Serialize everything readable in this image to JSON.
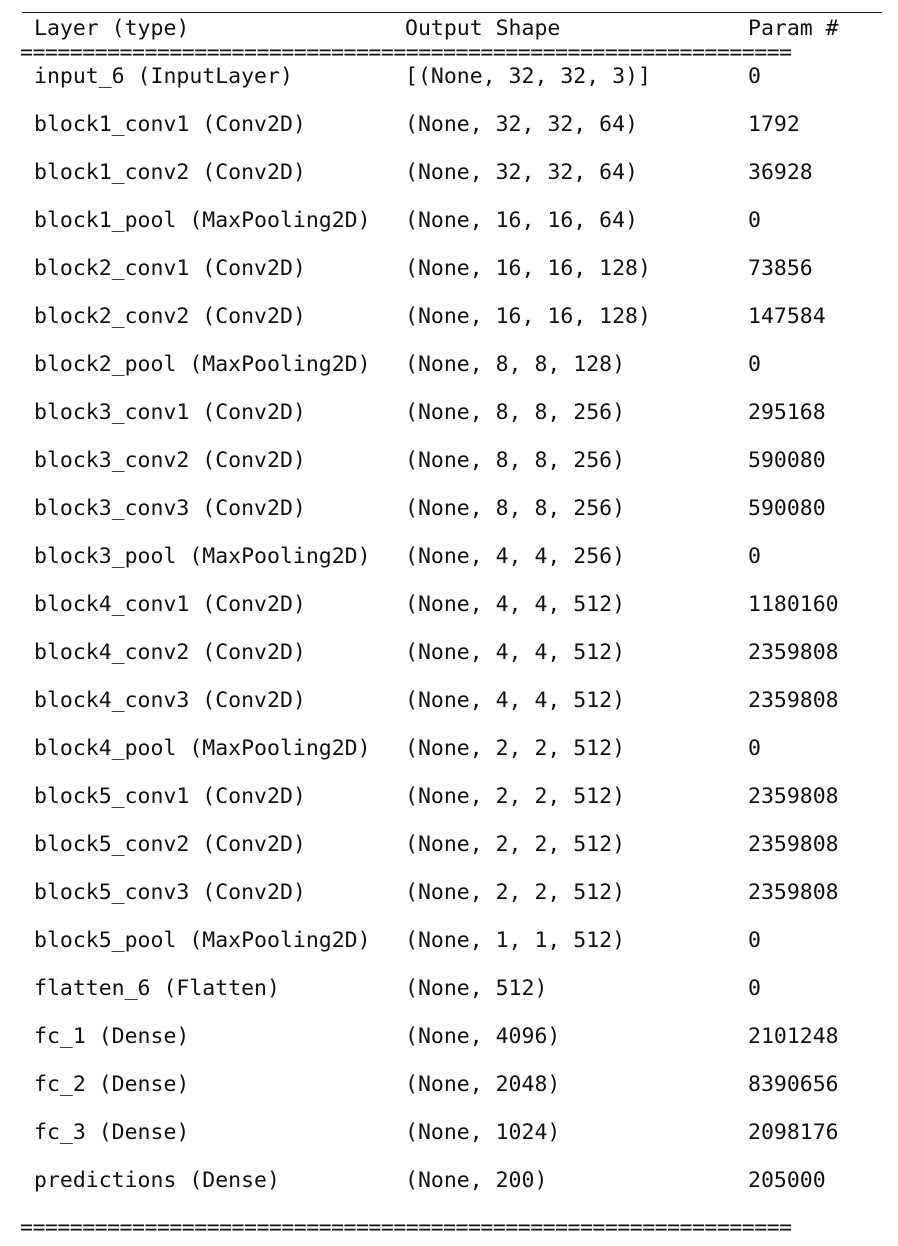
{
  "header": {
    "name": "Layer (type)",
    "shape": "Output Shape",
    "params": "Param #"
  },
  "separator": "==============================================================",
  "layers": [
    {
      "name": "input_6 (InputLayer)",
      "shape": "[(None, 32, 32, 3)]",
      "params": "0"
    },
    {
      "name": "block1_conv1 (Conv2D)",
      "shape": "(None, 32, 32, 64)",
      "params": "1792"
    },
    {
      "name": "block1_conv2 (Conv2D)",
      "shape": "(None, 32, 32, 64)",
      "params": "36928"
    },
    {
      "name": "block1_pool (MaxPooling2D)",
      "shape": "(None, 16, 16, 64)",
      "params": "0"
    },
    {
      "name": "block2_conv1 (Conv2D)",
      "shape": "(None, 16, 16, 128)",
      "params": "73856"
    },
    {
      "name": "block2_conv2 (Conv2D)",
      "shape": "(None, 16, 16, 128)",
      "params": "147584"
    },
    {
      "name": "block2_pool (MaxPooling2D)",
      "shape": "(None, 8, 8, 128)",
      "params": "0"
    },
    {
      "name": "block3_conv1 (Conv2D)",
      "shape": "(None, 8, 8, 256)",
      "params": "295168"
    },
    {
      "name": "block3_conv2 (Conv2D)",
      "shape": "(None, 8, 8, 256)",
      "params": "590080"
    },
    {
      "name": "block3_conv3 (Conv2D)",
      "shape": "(None, 8, 8, 256)",
      "params": "590080"
    },
    {
      "name": "block3_pool (MaxPooling2D)",
      "shape": "(None, 4, 4, 256)",
      "params": "0"
    },
    {
      "name": "block4_conv1 (Conv2D)",
      "shape": "(None, 4, 4, 512)",
      "params": "1180160"
    },
    {
      "name": "block4_conv2 (Conv2D)",
      "shape": "(None, 4, 4, 512)",
      "params": "2359808"
    },
    {
      "name": "block4_conv3 (Conv2D)",
      "shape": "(None, 4, 4, 512)",
      "params": "2359808"
    },
    {
      "name": "block4_pool (MaxPooling2D)",
      "shape": "(None, 2, 2, 512)",
      "params": "0"
    },
    {
      "name": "block5_conv1 (Conv2D)",
      "shape": "(None, 2, 2, 512)",
      "params": "2359808"
    },
    {
      "name": "block5_conv2 (Conv2D)",
      "shape": "(None, 2, 2, 512)",
      "params": "2359808"
    },
    {
      "name": "block5_conv3 (Conv2D)",
      "shape": "(None, 2, 2, 512)",
      "params": "2359808"
    },
    {
      "name": "block5_pool (MaxPooling2D)",
      "shape": "(None, 1, 1, 512)",
      "params": "0"
    },
    {
      "name": "flatten_6 (Flatten)",
      "shape": "(None, 512)",
      "params": "0"
    },
    {
      "name": "fc_1 (Dense)",
      "shape": "(None, 4096)",
      "params": "2101248"
    },
    {
      "name": "fc_2 (Dense)",
      "shape": "(None, 2048)",
      "params": "8390656"
    },
    {
      "name": "fc_3 (Dense)",
      "shape": "(None, 1024)",
      "params": "2098176"
    },
    {
      "name": "predictions (Dense)",
      "shape": "(None, 200)",
      "params": "205000"
    }
  ]
}
